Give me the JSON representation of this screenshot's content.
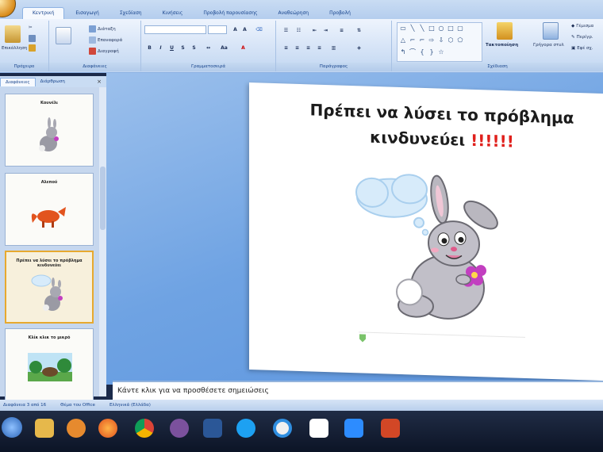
{
  "ribbon": {
    "tabs": [
      "Κεντρική",
      "Εισαγωγή",
      "Σχεδίαση",
      "Κινήσεις",
      "Προβολή παρουσίασης",
      "Αναθεώρηση",
      "Προβολή"
    ],
    "clipboard": {
      "cut": "Αποκοπή",
      "copy": "Αντιγραφή",
      "paste": "Επικόλληση"
    },
    "slides_group": {
      "layout": "Διάταξη",
      "reset": "Επαναφορά",
      "delete": "Διαγραφή"
    },
    "drawing": {
      "arrange": "Τακτοποίηση",
      "quick_styles": "Γρήγορα στυλ",
      "fill": "Γέμισμα",
      "outline": "Περίγρ.",
      "effects": "Εφέ σχ."
    },
    "group_labels": {
      "clipboard": "Πρόχειρο",
      "slides": "Διαφάνειες",
      "font": "Γραμματοσειρά",
      "paragraph": "Παράγραφος",
      "drawing": "Σχέδιαση"
    }
  },
  "slides_panel": {
    "tabs": [
      "Διαφάνειες",
      "Διάρθρωση"
    ],
    "slides": [
      {
        "number": "",
        "title": "Κουνέλι"
      },
      {
        "number": "",
        "title": "Αλεπού"
      },
      {
        "number": "",
        "title": "Πρέπει να λύσει το πρόβλημα κινδυνεύει"
      },
      {
        "number": "",
        "title": "Κλίκ κλικ το μικρό"
      }
    ],
    "selected_index": 2
  },
  "slide": {
    "title_line1": "Πρέπει να λύσει το πρόβλημα",
    "title_line2": "κινδυνεύει ",
    "title_exclaim": "!!!!!!",
    "accent_color": "#e0201c"
  },
  "notes": {
    "placeholder": "Κάντε κλικ για να προσθέσετε σημειώσεις"
  },
  "statusbar": {
    "slide_info": "Διαφάνεια 3 από 16",
    "theme": "Θέμα του Office",
    "language": "Ελληνικά (Ελλάδα)"
  },
  "taskbar": {
    "icons": [
      "start-icon",
      "file-explorer-icon",
      "media-player-icon",
      "firefox-icon",
      "chrome-icon",
      "viber-icon",
      "word-icon",
      "powerpoint-icon",
      "skype-icon",
      "browser-icon",
      "app-icon",
      "zoom-icon",
      "slides-icon"
    ]
  }
}
